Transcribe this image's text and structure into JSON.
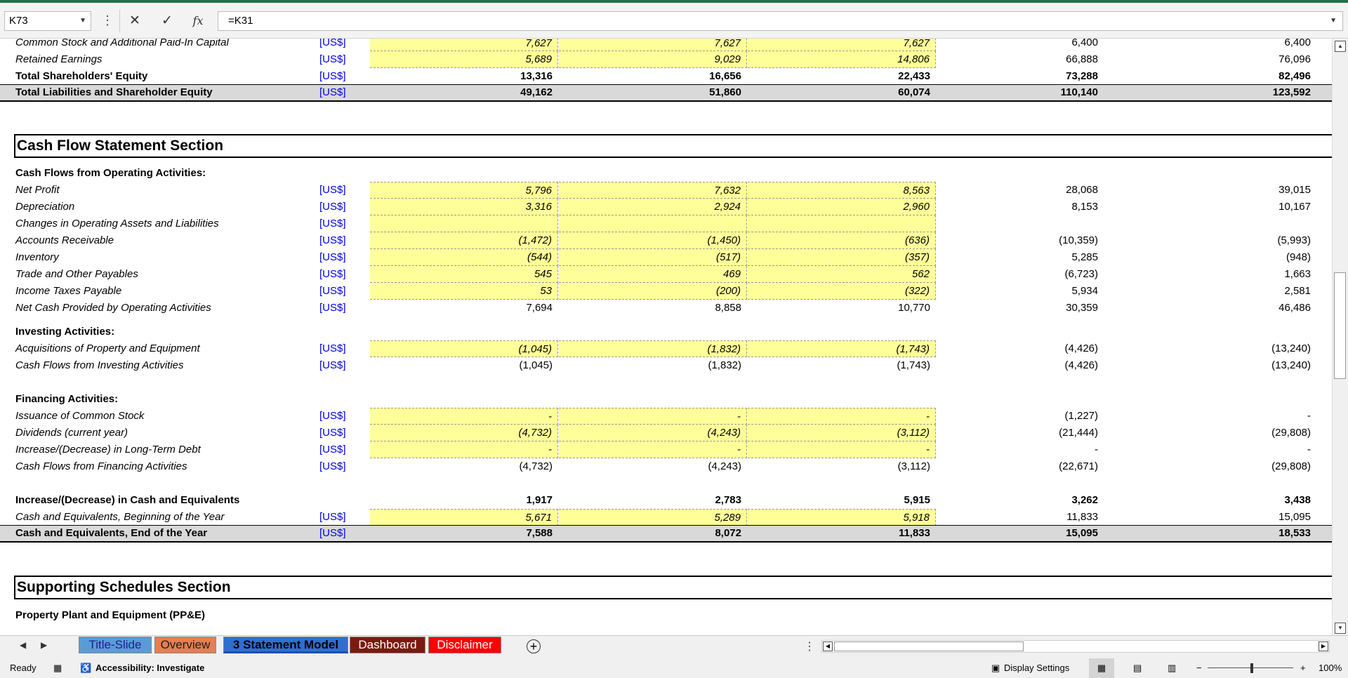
{
  "formula_bar": {
    "name_box": "K73",
    "formula": "=K31",
    "cancel_glyph": "✕",
    "enter_glyph": "✓",
    "fx_glyph": "fx"
  },
  "rows_equity": [
    {
      "label": "Common Stock and Additional Paid-In Capital",
      "unit": "[US$]",
      "v": [
        "7,627",
        "7,627",
        "7,627",
        "6,400",
        "6,400"
      ]
    },
    {
      "label": "Retained Earnings",
      "unit": "[US$]",
      "v": [
        "5,689",
        "9,029",
        "14,806",
        "66,888",
        "76,096"
      ]
    },
    {
      "label": "Total Shareholders' Equity",
      "unit": "[US$]",
      "v": [
        "13,316",
        "16,656",
        "22,433",
        "73,288",
        "82,496"
      ]
    },
    {
      "label": "Total Liabilities and Shareholder Equity",
      "unit": "[US$]",
      "v": [
        "49,162",
        "51,860",
        "60,074",
        "110,140",
        "123,592"
      ]
    }
  ],
  "cash_flow_title": "Cash Flow Statement Section",
  "operating_header": "Cash Flows from Operating Activities:",
  "rows_operating": [
    {
      "label": "Net Profit",
      "unit": "[US$]",
      "v": [
        "5,796",
        "7,632",
        "8,563",
        "28,068",
        "39,015"
      ]
    },
    {
      "label": "Depreciation",
      "unit": "[US$]",
      "v": [
        "3,316",
        "2,924",
        "2,960",
        "8,153",
        "10,167"
      ]
    },
    {
      "label": "Changes in Operating Assets and Liabilities",
      "unit": "[US$]",
      "v": [
        "",
        "",
        "",
        "",
        ""
      ]
    },
    {
      "label": "Accounts Receivable",
      "unit": "[US$]",
      "v": [
        "(1,472)",
        "(1,450)",
        "(636)",
        "(10,359)",
        "(5,993)"
      ]
    },
    {
      "label": "Inventory",
      "unit": "[US$]",
      "v": [
        "(544)",
        "(517)",
        "(357)",
        "5,285",
        "(948)"
      ]
    },
    {
      "label": "Trade and Other Payables",
      "unit": "[US$]",
      "v": [
        "545",
        "469",
        "562",
        "(6,723)",
        "1,663"
      ]
    },
    {
      "label": "Income Taxes Payable",
      "unit": "[US$]",
      "v": [
        "53",
        "(200)",
        "(322)",
        "5,934",
        "2,581"
      ]
    },
    {
      "label": "Net Cash Provided by Operating Activities",
      "unit": "[US$]",
      "v": [
        "7,694",
        "8,858",
        "10,770",
        "30,359",
        "46,486"
      ]
    }
  ],
  "investing_header": "Investing Activities:",
  "rows_investing": [
    {
      "label": "Acquisitions of Property and Equipment",
      "unit": "[US$]",
      "v": [
        "(1,045)",
        "(1,832)",
        "(1,743)",
        "(4,426)",
        "(13,240)"
      ]
    },
    {
      "label": "Cash Flows from Investing Activities",
      "unit": "[US$]",
      "v": [
        "(1,045)",
        "(1,832)",
        "(1,743)",
        "(4,426)",
        "(13,240)"
      ]
    }
  ],
  "financing_header": "Financing Activities:",
  "rows_financing": [
    {
      "label": "Issuance of Common Stock",
      "unit": "[US$]",
      "v": [
        "-",
        "-",
        "-",
        "(1,227)",
        "-"
      ]
    },
    {
      "label": "Dividends (current year)",
      "unit": "[US$]",
      "v": [
        "(4,732)",
        "(4,243)",
        "(3,112)",
        "(21,444)",
        "(29,808)"
      ]
    },
    {
      "label": "Increase/(Decrease) in Long-Term Debt",
      "unit": "[US$]",
      "v": [
        "-",
        "-",
        "-",
        "-",
        "-"
      ]
    },
    {
      "label": "Cash Flows from Financing Activities",
      "unit": "[US$]",
      "v": [
        "(4,732)",
        "(4,243)",
        "(3,112)",
        "(22,671)",
        "(29,808)"
      ]
    }
  ],
  "rows_cash": [
    {
      "label": "Increase/(Decrease) in Cash and Equivalents",
      "unit": "",
      "v": [
        "1,917",
        "2,783",
        "5,915",
        "3,262",
        "3,438"
      ]
    },
    {
      "label": "Cash and Equivalents, Beginning of the Year",
      "unit": "[US$]",
      "v": [
        "5,671",
        "5,289",
        "5,918",
        "11,833",
        "15,095"
      ]
    },
    {
      "label": "Cash and Equivalents, End of the Year",
      "unit": "[US$]",
      "v": [
        "7,588",
        "8,072",
        "11,833",
        "15,095",
        "18,533"
      ]
    }
  ],
  "supporting_title": "Supporting Schedules Section",
  "ppe_header": "Property Plant and Equipment (PP&E)",
  "tabs": [
    {
      "label": "Title-Slide",
      "bg": "#5b9bd5",
      "fg": "#1f1f8f"
    },
    {
      "label": "Overview",
      "bg": "#e67e50",
      "fg": "#1f1f1f"
    },
    {
      "label": "3 Statement Model",
      "bg": "#2f6fd0",
      "fg": "#000000"
    },
    {
      "label": "Dashboard",
      "bg": "#7b1a0e",
      "fg": "#ffffff"
    },
    {
      "label": "Disclaimer",
      "bg": "#ff0000",
      "fg": "#ffffff"
    }
  ],
  "status": {
    "ready": "Ready",
    "accessibility": "Accessibility: Investigate",
    "display_settings": "Display Settings",
    "zoom": "100%"
  }
}
